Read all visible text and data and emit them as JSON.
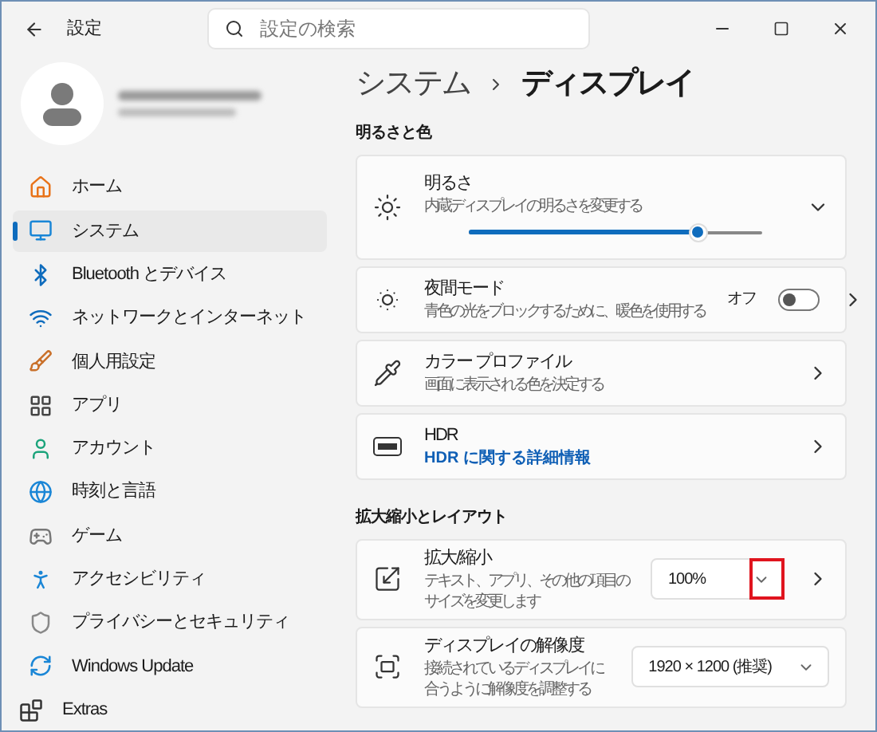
{
  "window": {
    "title": "設定"
  },
  "search": {
    "placeholder": "設定の検索"
  },
  "sidebar": {
    "items": [
      {
        "label": "ホーム",
        "selected": false
      },
      {
        "label": "システム",
        "selected": true
      },
      {
        "label": "Bluetooth とデバイス",
        "selected": false
      },
      {
        "label": "ネットワークとインターネット",
        "selected": false
      },
      {
        "label": "個人用設定",
        "selected": false
      },
      {
        "label": "アプリ",
        "selected": false
      },
      {
        "label": "アカウント",
        "selected": false
      },
      {
        "label": "時刻と言語",
        "selected": false
      },
      {
        "label": "ゲーム",
        "selected": false
      },
      {
        "label": "アクセシビリティ",
        "selected": false
      },
      {
        "label": "プライバシーとセキュリティ",
        "selected": false
      },
      {
        "label": "Windows Update",
        "selected": false
      },
      {
        "label": "Extras",
        "selected": false
      }
    ]
  },
  "breadcrumb": {
    "parent": "システム",
    "current": "ディスプレイ"
  },
  "sections": [
    {
      "title": "明るさと色",
      "cards": [
        {
          "kind": "slider",
          "title": "明るさ",
          "description": "内蔵ディスプレイの明るさを変更する",
          "level": 0.78,
          "expanded": false
        },
        {
          "kind": "toggle",
          "title": "夜間モード",
          "description": "青色の光をブロックするために、暖色を使用する",
          "state_label": "オフ",
          "on": false
        },
        {
          "kind": "link",
          "title": "カラー プロファイル",
          "description": "画面に表示される色を決定する"
        },
        {
          "kind": "hdr",
          "title": "HDR",
          "link": "HDR に関する詳細情報"
        }
      ]
    },
    {
      "title": "拡大縮小とレイアウト",
      "cards": [
        {
          "kind": "dropdown",
          "title": "拡大/縮小",
          "description": "テキスト、アプリ、その他の項目のサイズを変更します",
          "value": "100%",
          "highlighted": true,
          "chevron": true
        },
        {
          "kind": "dropdown",
          "title": "ディスプレイの解像度",
          "description": "接続されているディスプレイに合うように解像度を調整する",
          "value": "1920 × 1200 (推奨)",
          "highlighted": false,
          "chevron": false
        }
      ]
    }
  ]
}
